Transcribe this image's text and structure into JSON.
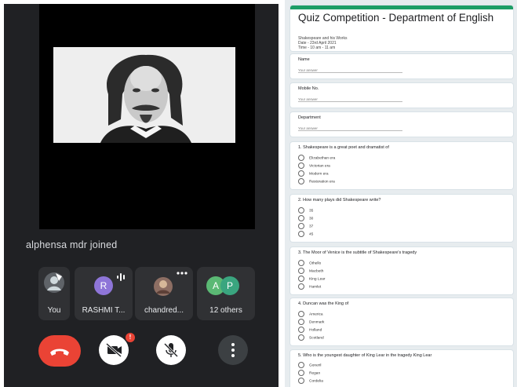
{
  "meet": {
    "toast": "alphensa mdr joined",
    "tiles": [
      {
        "label": "You"
      },
      {
        "label": "RASHMI T...",
        "initial": "R"
      },
      {
        "label": "chandred..."
      },
      {
        "label": "12 others",
        "initials": [
          "A",
          "P"
        ]
      }
    ],
    "cam_badge": "!"
  },
  "form": {
    "title": "Quiz Competition - Department of English",
    "subtitle_lines": [
      "Shakespeare and his Works",
      "Date - 23rd April 2021",
      "Time - 10 am - 11 am"
    ],
    "text_questions": [
      {
        "label": "Name",
        "answer_placeholder": "Your answer"
      },
      {
        "label": "Mobile No.",
        "answer_placeholder": "Your answer"
      },
      {
        "label": "Department",
        "answer_placeholder": "Your answer"
      }
    ],
    "mc_questions": [
      {
        "label": "1. Shakespeare is a great poet and dramatist of",
        "options": [
          "Elizabethan era",
          "Victorian era",
          "Modern era",
          "Restoration era"
        ]
      },
      {
        "label": "2. How many plays did Shakespeare write?",
        "options": [
          "35",
          "30",
          "37",
          "45"
        ]
      },
      {
        "label": "3. The Moor of Venice is the subtitle of Shakespeare's tragedy",
        "options": [
          "Othello",
          "Macbeth",
          "King Lear",
          "Hamlet"
        ]
      },
      {
        "label": "4. Duncan was the King of",
        "options": [
          "America",
          "Denmark",
          "Holland",
          "Scotland"
        ]
      },
      {
        "label": "5. Who is the youngest daughter of King Lear in the tragedy King Lear",
        "options": [
          "Goneril",
          "Regan",
          "Cordelia"
        ]
      }
    ]
  },
  "colors": {
    "meet_bg": "#202124",
    "tile_bg": "#303134",
    "end_call": "#ea4335",
    "avatar_r": "#8e75d8",
    "avatar_a": "#5bb974",
    "avatar_p": "#3aa57f",
    "form_accent": "#1d9e66"
  }
}
